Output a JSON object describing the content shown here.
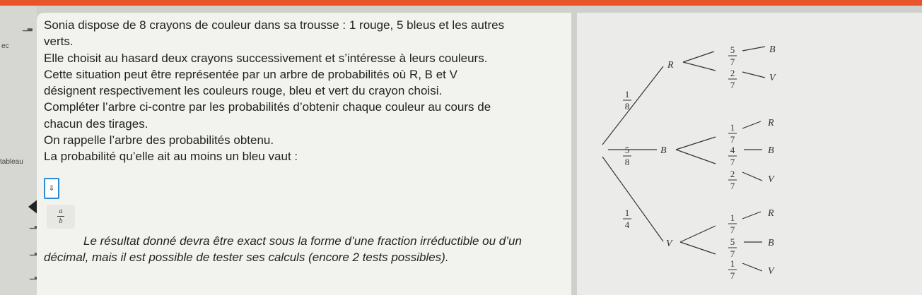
{
  "sidebar": {
    "labels": [
      "ec",
      "tableau"
    ]
  },
  "question": {
    "lines": [
      "Sonia dispose de 8 crayons de couleur dans sa trousse : 1 rouge, 5 bleus et les autres",
      "verts.",
      "Elle choisit au hasard deux crayons successivement et s’intéresse à leurs couleurs.",
      "Cette situation peut être représentée par un arbre de probabilités où R, B et V",
      "désignent respectivement les couleurs rouge, bleu et vert du crayon choisi.",
      "Compléter l’arbre ci-contre par les probabilités d’obtenir chaque couleur au cours de",
      "chacun des tirages.",
      "On rappelle l’arbre des probabilités obtenu.",
      "La probabilité qu’elle ait au moins un bleu vaut :"
    ],
    "fraction_button": {
      "num": "a",
      "den": "b"
    },
    "note_line1": "Le résultat donné devra être exact sous la forme d’une fraction irréductible ou d’un",
    "note_line2": "décimal, mais il est possible de tester ses calculs (encore 2 tests possibles)."
  },
  "tree": {
    "first": [
      {
        "label": "R",
        "num": "1",
        "den": "8"
      },
      {
        "label": "B",
        "num": "5",
        "den": "8"
      },
      {
        "label": "V",
        "num": "1",
        "den": "4"
      }
    ],
    "second": [
      [
        {
          "label": "B",
          "num": "5",
          "den": "7"
        },
        {
          "label": "V",
          "num": "2",
          "den": "7"
        }
      ],
      [
        {
          "label": "R",
          "num": "1",
          "den": "7"
        },
        {
          "label": "B",
          "num": "4",
          "den": "7"
        },
        {
          "label": "V",
          "num": "2",
          "den": "7"
        }
      ],
      [
        {
          "label": "R",
          "num": "1",
          "den": "7"
        },
        {
          "label": "B",
          "num": "5",
          "den": "7"
        },
        {
          "label": "V",
          "num": "1",
          "den": "7"
        }
      ]
    ]
  }
}
